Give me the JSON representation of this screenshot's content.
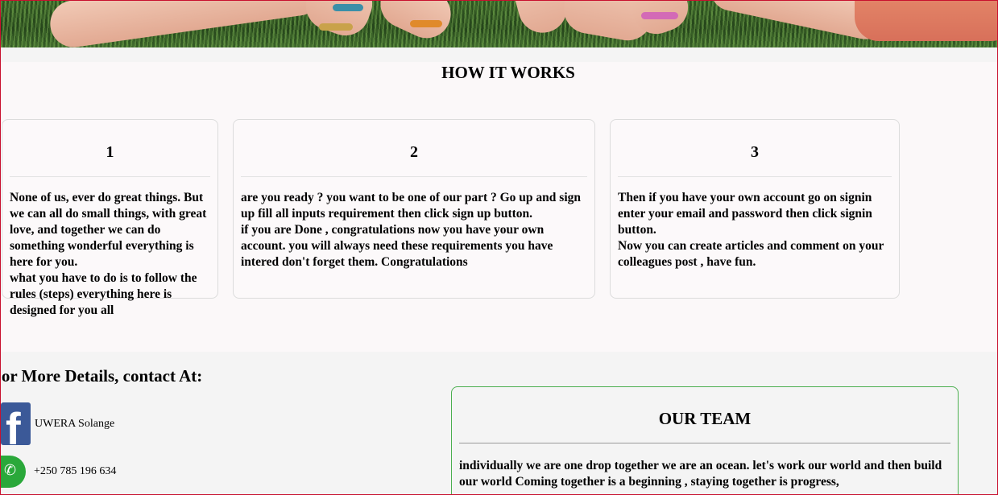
{
  "how_it_works": {
    "title": "HOW IT WORKS",
    "steps": [
      {
        "number": "1",
        "paragraphs": [
          "None of us, ever do great things. But we can all do small things, with great love, and together we can do something wonderful everything is here for you.",
          "what you have to do is to follow the rules (steps) everything here is designed for you all"
        ]
      },
      {
        "number": "2",
        "paragraphs": [
          "are you ready ? you want to be one of our part ? Go up and sign up fill all inputs requirement then click sign up button.",
          "if you are Done , congratulations now you have your own account. you will always need these requirements you have intered don't forget them. Congratulations"
        ]
      },
      {
        "number": "3",
        "paragraphs": [
          "Then if you have your own account go on signin enter your email and password then click signin button.",
          "Now you can create articles and comment on your colleagues post , have fun."
        ]
      }
    ]
  },
  "contact": {
    "heading": "For More Details, contact At:",
    "facebook": {
      "icon": "facebook-icon",
      "text": "UWERA Solange"
    },
    "whatsapp": {
      "icon": "whatsapp-icon",
      "text": "+250 785 196 634"
    }
  },
  "team": {
    "title": "OUR TEAM",
    "text": "individually we are one drop together we are an ocean. let's work our world and then build our world Coming together is a beginning , staying together is progress,"
  },
  "colors": {
    "frame_border": "#c8102e",
    "facebook": "#3b5998",
    "whatsapp": "#2aa83a",
    "team_border": "#4caf50"
  }
}
